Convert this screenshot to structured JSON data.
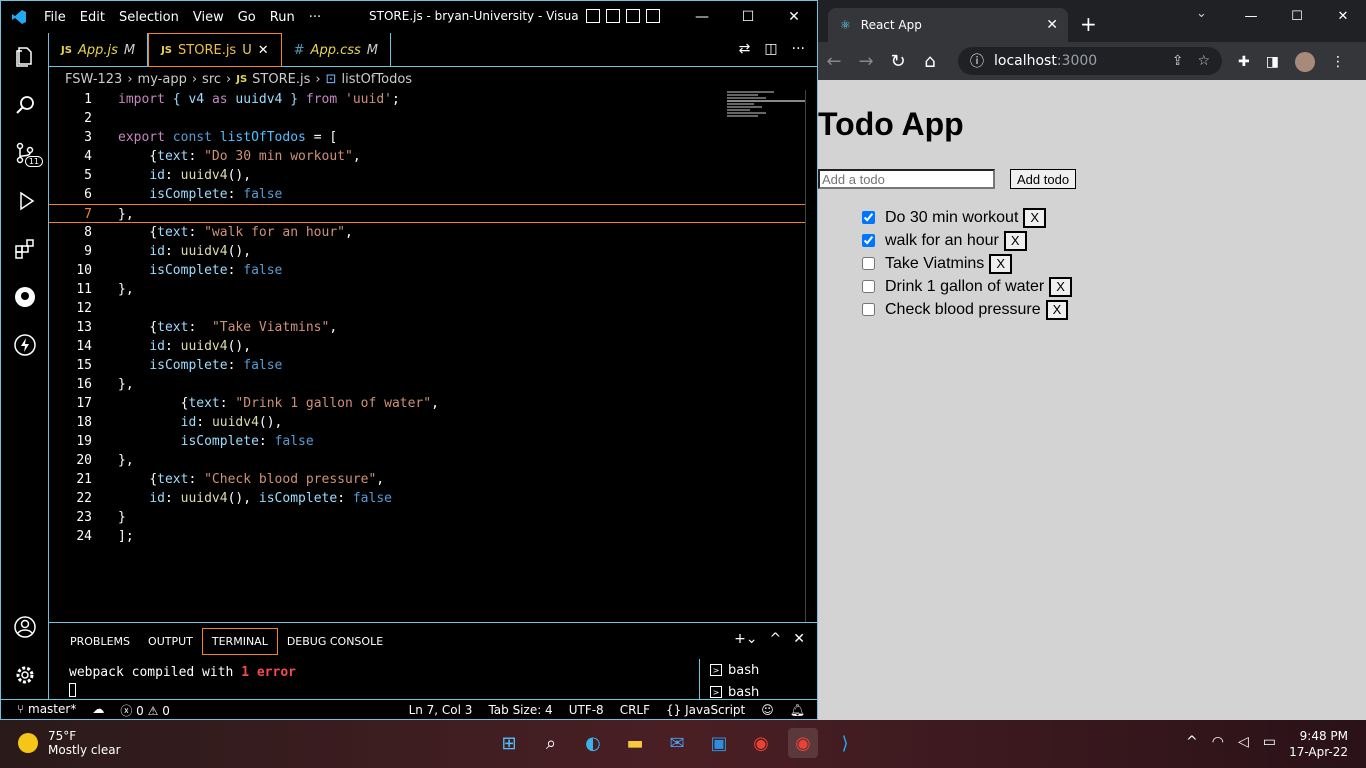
{
  "vscode": {
    "title": "STORE.js - bryan-University - Visual St...",
    "menu": [
      "File",
      "Edit",
      "Selection",
      "View",
      "Go",
      "Run",
      "···"
    ],
    "tabs": [
      {
        "label": "App.js",
        "type": "JS",
        "status": "M"
      },
      {
        "label": "STORE.js",
        "type": "JS",
        "status": "U"
      },
      {
        "label": "App.css",
        "type": "#",
        "status": "M"
      }
    ],
    "breadcrumb": [
      "FSW-123",
      "my-app",
      "src",
      "STORE.js",
      "listOfTodos"
    ],
    "scm_badge": "11",
    "code_lines": [
      {
        "n": "1"
      },
      {
        "n": "2"
      },
      {
        "n": "3"
      },
      {
        "n": "4"
      },
      {
        "n": "5"
      },
      {
        "n": "6"
      },
      {
        "n": "7"
      },
      {
        "n": "8"
      },
      {
        "n": "9"
      },
      {
        "n": "10"
      },
      {
        "n": "11"
      },
      {
        "n": "12"
      },
      {
        "n": "13"
      },
      {
        "n": "14"
      },
      {
        "n": "15"
      },
      {
        "n": "16"
      },
      {
        "n": "17"
      },
      {
        "n": "18"
      },
      {
        "n": "19"
      },
      {
        "n": "20"
      },
      {
        "n": "21"
      },
      {
        "n": "22"
      },
      {
        "n": "23"
      },
      {
        "n": "24"
      }
    ],
    "code": {
      "l1": [
        "import",
        "{ v4",
        "as",
        "uuidv4 }",
        "from",
        "'uuid'",
        ";"
      ],
      "l3": [
        "export",
        "const",
        "listOfTodos",
        "= ["
      ],
      "todo_texts": [
        "\"Do 30 min workout\"",
        "\"walk for an hour\"",
        "\"Take Viatmins\"",
        "\"Drink 1 gallon of water\"",
        "\"Check blood pressure\""
      ],
      "text_key": "text",
      "id_key": "id",
      "fn": "uuidv4",
      "complete_key": "isComplete",
      "false": "false"
    },
    "panel_tabs": [
      "PROBLEMS",
      "OUTPUT",
      "TERMINAL",
      "DEBUG CONSOLE"
    ],
    "terminal": {
      "prefix": "webpack compiled with ",
      "error": "1 error"
    },
    "terminals": [
      "bash",
      "bash"
    ],
    "status": {
      "branch": "master*",
      "errors": "0",
      "warnings": "0",
      "position": "Ln 7, Col 3",
      "tab_size": "Tab Size: 4",
      "encoding": "UTF-8",
      "eol": "CRLF",
      "language": "JavaScript"
    }
  },
  "chrome": {
    "tab_title": "React App",
    "url_host": "localhost",
    "url_port": ":3000",
    "page_title": "Todo App",
    "input_placeholder": "Add a todo",
    "add_label": "Add todo",
    "todos": [
      {
        "text": "Do 30 min workout",
        "done": true
      },
      {
        "text": "walk for an hour",
        "done": true
      },
      {
        "text": "Take Viatmins",
        "done": false
      },
      {
        "text": "Drink 1 gallon of water",
        "done": false
      },
      {
        "text": "Check blood pressure",
        "done": false
      }
    ],
    "delete_label": "X"
  },
  "taskbar": {
    "temp": "75°F",
    "weather": "Mostly clear",
    "time": "9:48 PM",
    "date": "17-Apr-22"
  }
}
